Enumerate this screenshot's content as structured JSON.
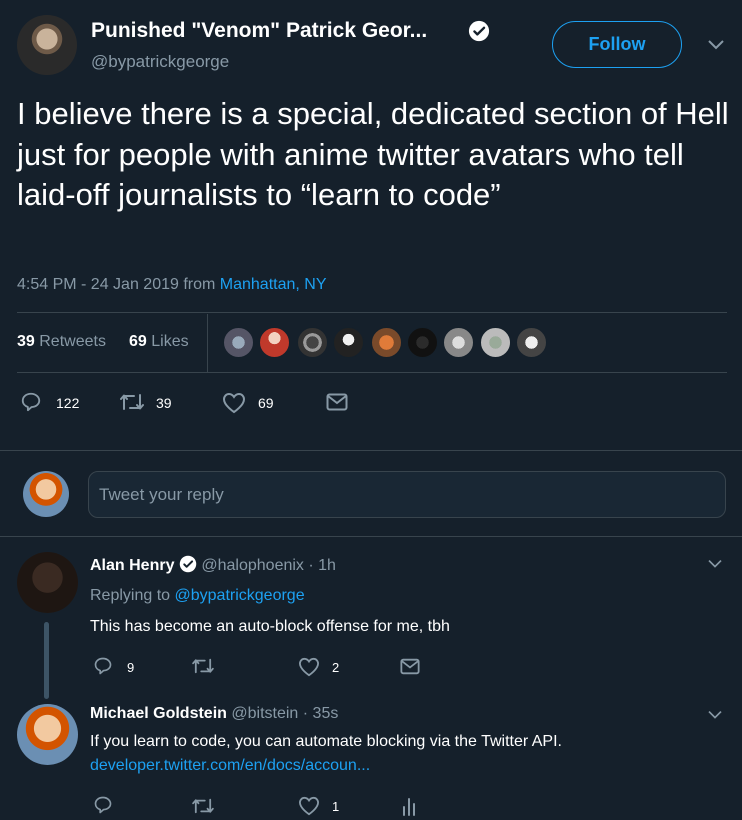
{
  "author": {
    "name": "Punished \"Venom\" Patrick Geor...",
    "handle": "@bypatrickgeorge",
    "verified": true
  },
  "follow_label": "Follow",
  "tweet": {
    "text": "I believe there is a special, dedicated section of Hell just for people with anime twitter avatars who tell laid-off journalists to “learn to code”",
    "timestamp": "4:54 PM - 24 Jan 2019 from ",
    "location": "Manhattan, NY"
  },
  "stats": {
    "retweets_count": "39",
    "retweets_label": "Retweets",
    "likes_count": "69",
    "likes_label": "Likes"
  },
  "actions": {
    "replies": "122",
    "retweets": "39",
    "likes": "69"
  },
  "reply_placeholder": "Tweet your reply",
  "replies": [
    {
      "name": "Alan Henry",
      "verified": true,
      "handle": "@halophoenix",
      "time": "· 1h",
      "replying_to_label": "Replying to ",
      "replying_to": "@bypatrickgeorge",
      "text": "This has become an auto-block offense for me, tbh",
      "reply_count": "9",
      "retweet_count": "",
      "like_count": "2"
    },
    {
      "name": "Michael Goldstein",
      "handle": "@bitstein",
      "time": "· 35s",
      "text": "If you learn to code, you can automate blocking via the Twitter API.",
      "link": "developer.twitter.com/en/docs/accoun...",
      "reply_count": "",
      "retweet_count": "",
      "like_count": "1"
    }
  ],
  "colors": {
    "background": "#15202b",
    "accent": "#1da1f2",
    "secondary_text": "#8899a6",
    "divider": "#38444d"
  },
  "icons": [
    "verified-badge-icon",
    "chevron-down-icon",
    "reply-icon",
    "retweet-icon",
    "like-icon",
    "message-icon",
    "analytics-icon"
  ]
}
